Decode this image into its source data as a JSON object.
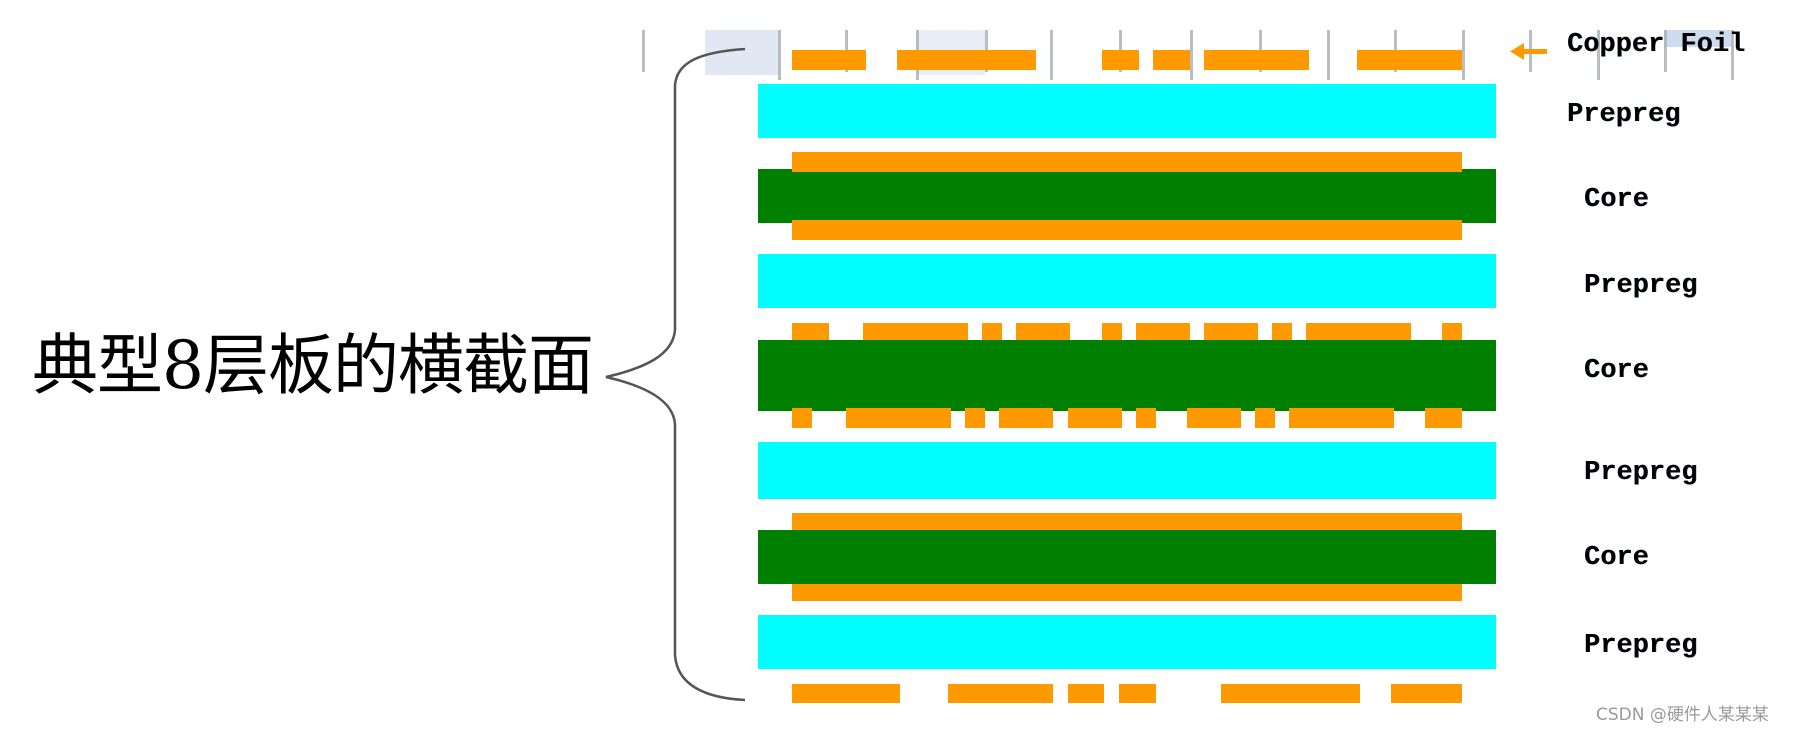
{
  "title": "典型8层板的横截面",
  "watermark": "CSDN @硬件人某某某",
  "colors": {
    "copper": "#ff9900",
    "prepreg": "#00ffff",
    "core": "#008000",
    "brace": "#555555",
    "ruler_tick": "#a8aeb6",
    "ruler_highlight": "#dfe6f2",
    "arrow": "#ff9900"
  },
  "labels": [
    {
      "id": "copper-foil",
      "text": "Copper Foil",
      "arrow": true
    },
    {
      "id": "prepreg-1",
      "text": "Prepreg"
    },
    {
      "id": "core-1",
      "text": "Core"
    },
    {
      "id": "prepreg-2",
      "text": "Prepreg"
    },
    {
      "id": "core-2",
      "text": "Core"
    },
    {
      "id": "prepreg-3",
      "text": "Prepreg"
    },
    {
      "id": "core-3",
      "text": "Core"
    },
    {
      "id": "prepreg-4",
      "text": "Prepreg"
    }
  ],
  "stackup": {
    "layer_count": 8,
    "order": [
      "Copper Foil (L1)",
      "Prepreg",
      "Core (L2/L3)",
      "Prepreg",
      "Core (L4/L5)",
      "Prepreg",
      "Core (L6/L7)",
      "Prepreg",
      "Copper Foil (L8)"
    ],
    "copper_layers": [
      {
        "layer": "L1",
        "type": "signal",
        "pattern": "patterned"
      },
      {
        "layer": "L2",
        "type": "plane",
        "pattern": "solid"
      },
      {
        "layer": "L3",
        "type": "plane",
        "pattern": "solid"
      },
      {
        "layer": "L4",
        "type": "signal",
        "pattern": "patterned"
      },
      {
        "layer": "L5",
        "type": "signal",
        "pattern": "patterned"
      },
      {
        "layer": "L6",
        "type": "plane",
        "pattern": "solid"
      },
      {
        "layer": "L7",
        "type": "plane",
        "pattern": "solid"
      },
      {
        "layer": "L8",
        "type": "signal",
        "pattern": "patterned"
      }
    ]
  }
}
